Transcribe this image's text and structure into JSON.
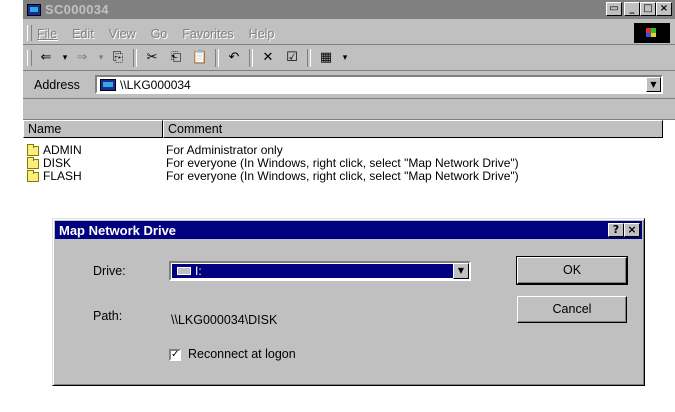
{
  "window": {
    "title": "SC000034",
    "buttons": [
      "▭",
      "_",
      "□",
      "×"
    ]
  },
  "menu": {
    "items": [
      {
        "label": "File",
        "underline": "F"
      },
      {
        "label": "Edit",
        "underline": "E"
      },
      {
        "label": "View",
        "underline": "V"
      },
      {
        "label": "Go",
        "underline": "G"
      },
      {
        "label": "Favorites",
        "underline": "a"
      },
      {
        "label": "Help",
        "underline": "H"
      }
    ]
  },
  "toolbar": {
    "icons": [
      {
        "name": "back-icon",
        "glyph": "⇐"
      },
      {
        "name": "back-dropdown-icon",
        "glyph": "▾"
      },
      {
        "name": "forward-icon",
        "glyph": "⇒"
      },
      {
        "name": "forward-dropdown-icon",
        "glyph": "▾"
      },
      {
        "name": "up-folder-icon",
        "glyph": "⎘"
      },
      {
        "name": "cut-icon",
        "glyph": "✂"
      },
      {
        "name": "copy-icon",
        "glyph": "⎗"
      },
      {
        "name": "paste-icon",
        "glyph": "📋"
      },
      {
        "name": "undo-icon",
        "glyph": "↶"
      },
      {
        "name": "delete-icon",
        "glyph": "✕"
      },
      {
        "name": "properties-icon",
        "glyph": "☑"
      },
      {
        "name": "views-icon",
        "glyph": "▦"
      },
      {
        "name": "views-dropdown-icon",
        "glyph": "▾"
      }
    ]
  },
  "address": {
    "label": "Address",
    "value": "\\\\LKG000034"
  },
  "list": {
    "columns": [
      "Name",
      "Comment"
    ],
    "rows": [
      {
        "name": "ADMIN",
        "comment": "For Administrator only"
      },
      {
        "name": "DISK",
        "comment": "For everyone (In Windows, right click, select \"Map Network Drive\")"
      },
      {
        "name": "FLASH",
        "comment": "For everyone (In Windows, right click, select \"Map Network Drive\")"
      }
    ]
  },
  "dialog": {
    "title": "Map Network Drive",
    "help_button": "?",
    "close_button": "×",
    "drive_label": "Drive:",
    "drive_value": "I:",
    "path_label": "Path:",
    "path_value": "\\\\LKG000034\\DISK",
    "reconnect_label": "Reconnect at logon",
    "reconnect_checked": true,
    "ok_label": "OK",
    "cancel_label": "Cancel"
  }
}
